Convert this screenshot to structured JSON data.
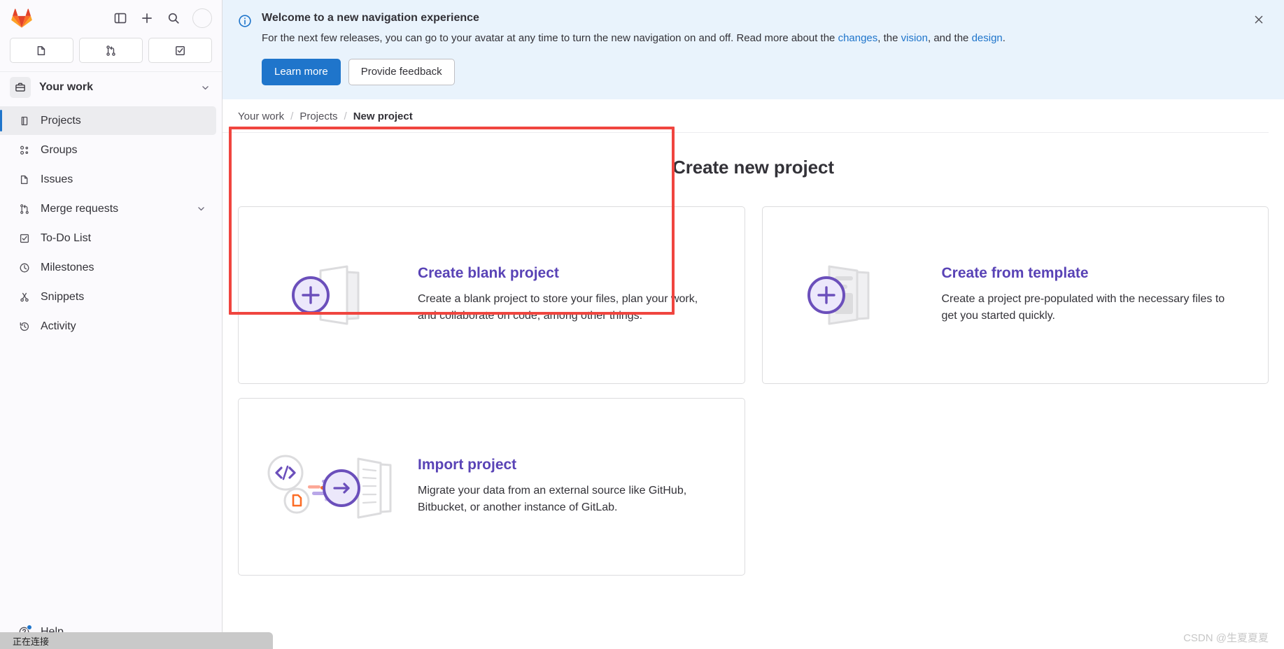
{
  "sidebar": {
    "logo_name": "gitlab-logo",
    "top_icons": [
      {
        "name": "sidebar-toggle-icon",
        "label": "Toggle sidebar"
      },
      {
        "name": "new-item-icon",
        "label": "Create new"
      },
      {
        "name": "search-icon",
        "label": "Search"
      }
    ],
    "avatar_label": "User avatar",
    "quick_actions": [
      {
        "name": "issues-quick-icon",
        "label": "Issues"
      },
      {
        "name": "merge-requests-quick-icon",
        "label": "Merge requests"
      },
      {
        "name": "todo-quick-icon",
        "label": "To-Do List"
      }
    ],
    "section": {
      "label": "Your work",
      "icon": "work-briefcase-icon",
      "chevron": "chevron-down-icon"
    },
    "items": [
      {
        "label": "Projects",
        "icon": "projects-icon",
        "active": true,
        "chevron": null
      },
      {
        "label": "Groups",
        "icon": "groups-icon",
        "active": false,
        "chevron": null
      },
      {
        "label": "Issues",
        "icon": "issues-icon",
        "active": false,
        "chevron": null
      },
      {
        "label": "Merge requests",
        "icon": "merge-requests-icon",
        "active": false,
        "chevron": "chevron-down-icon"
      },
      {
        "label": "To-Do List",
        "icon": "todo-icon",
        "active": false,
        "chevron": null
      },
      {
        "label": "Milestones",
        "icon": "milestones-clock-icon",
        "active": false,
        "chevron": null
      },
      {
        "label": "Snippets",
        "icon": "snippets-scissors-icon",
        "active": false,
        "chevron": null
      },
      {
        "label": "Activity",
        "icon": "activity-history-icon",
        "active": false,
        "chevron": null
      }
    ],
    "help": {
      "label": "Help",
      "icon": "help-question-icon",
      "has_notification_dot": true
    }
  },
  "banner": {
    "icon": "info-circle-icon",
    "title": "Welcome to a new navigation experience",
    "text_parts": [
      {
        "type": "text",
        "value": "For the next few releases, you can go to your avatar at any time to turn the new navigation on and off. Read more about the "
      },
      {
        "type": "link",
        "value": "changes"
      },
      {
        "type": "text",
        "value": ", the "
      },
      {
        "type": "link",
        "value": "vision"
      },
      {
        "type": "text",
        "value": ", and the "
      },
      {
        "type": "link",
        "value": "design"
      },
      {
        "type": "text",
        "value": "."
      }
    ],
    "primary_button": "Learn more",
    "secondary_button": "Provide feedback",
    "close_icon": "close-icon"
  },
  "breadcrumb": {
    "items": [
      {
        "label": "Your work",
        "current": false
      },
      {
        "label": "Projects",
        "current": false
      },
      {
        "label": "New project",
        "current": true
      }
    ],
    "separator": "/"
  },
  "main": {
    "page_title": "Create new project",
    "cards": [
      {
        "title": "Create blank project",
        "description": "Create a blank project to store your files, plan your work, and collaborate on code, among other things.",
        "icon": "blank-project-icon",
        "highlighted": true
      },
      {
        "title": "Create from template",
        "description": "Create a project pre-populated with the necessary files to get you started quickly.",
        "icon": "template-project-icon",
        "highlighted": false
      },
      {
        "title": "Import project",
        "description": "Migrate your data from an external source like GitHub, Bitbucket, or another instance of GitLab.",
        "icon": "import-project-icon",
        "highlighted": false
      }
    ]
  },
  "statusbar": {
    "text": "正在连接"
  },
  "watermark": {
    "text": "CSDN @生夏夏夏"
  },
  "colors": {
    "accent_blue": "#1f75cb",
    "purple": "#5943b6",
    "banner_bg": "#e9f3fc",
    "annotation_red": "#f0453f",
    "sidebar_bg": "#fbfafd"
  }
}
